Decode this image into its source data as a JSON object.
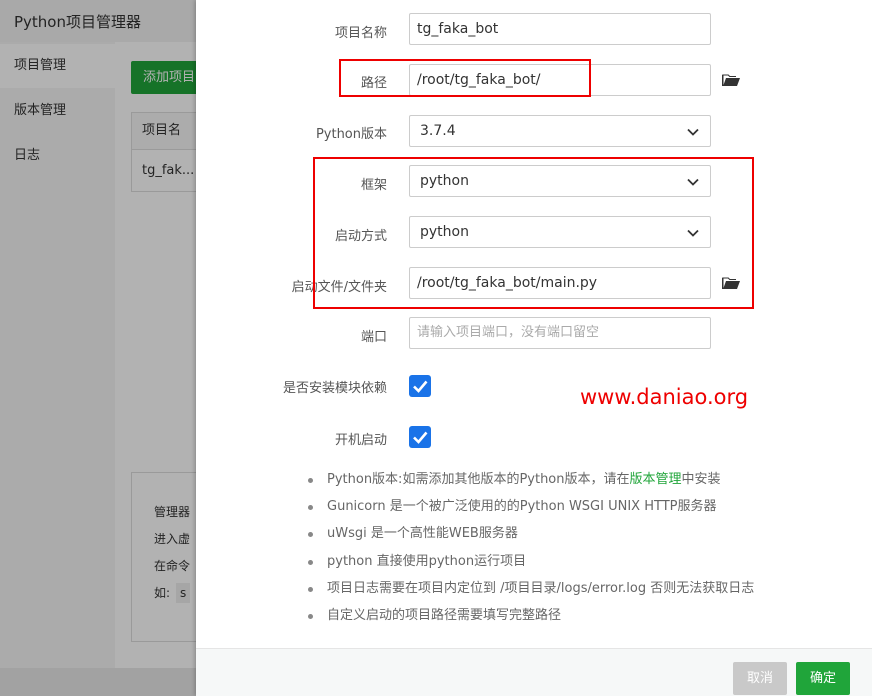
{
  "app": {
    "title": "Python项目管理器"
  },
  "sidebar": {
    "items": [
      {
        "label": "项目管理"
      },
      {
        "label": "版本管理"
      },
      {
        "label": "日志"
      }
    ]
  },
  "main": {
    "add_button": "添加项目",
    "table": {
      "header": "项目名",
      "row": "tg_fak..."
    },
    "info": {
      "line1": "管理器",
      "line2": "进入虚",
      "line3": "在命令",
      "line4": "如:",
      "code": "s"
    }
  },
  "form": {
    "name": {
      "label": "项目名称",
      "value": "tg_faka_bot"
    },
    "path": {
      "label": "路径",
      "value": "/root/tg_faka_bot/"
    },
    "python_version": {
      "label": "Python版本",
      "value": "3.7.4"
    },
    "framework": {
      "label": "框架",
      "value": "python"
    },
    "start_mode": {
      "label": "启动方式",
      "value": "python"
    },
    "start_file": {
      "label": "启动文件/文件夹",
      "value": "/root/tg_faka_bot/main.py"
    },
    "port": {
      "label": "端口",
      "value": "",
      "placeholder": "请输入项目端口，没有端口留空"
    },
    "install_deps": {
      "label": "是否安装模块依赖",
      "checked": true
    },
    "autostart": {
      "label": "开机启动",
      "checked": true
    }
  },
  "tips": [
    {
      "before": "Python版本:如需添加其他版本的Python版本，请在",
      "link": "版本管理",
      "after": "中安装"
    },
    {
      "text": "Gunicorn 是一个被广泛使用的的Python WSGI UNIX HTTP服务器"
    },
    {
      "text": "uWsgi 是一个高性能WEB服务器"
    },
    {
      "text": "python 直接使用python运行项目"
    },
    {
      "text": "项目日志需要在项目内定位到 /项目目录/logs/error.log 否则无法获取日志"
    },
    {
      "text": "自定义启动的项目路径需要填写完整路径"
    }
  ],
  "buttons": {
    "cancel": "取消",
    "confirm": "确定"
  },
  "watermark": "www.daniao.org",
  "colors": {
    "accent_green": "#20a53a",
    "checkbox_blue": "#1a73e8",
    "annotation_red": "#ee0000"
  }
}
